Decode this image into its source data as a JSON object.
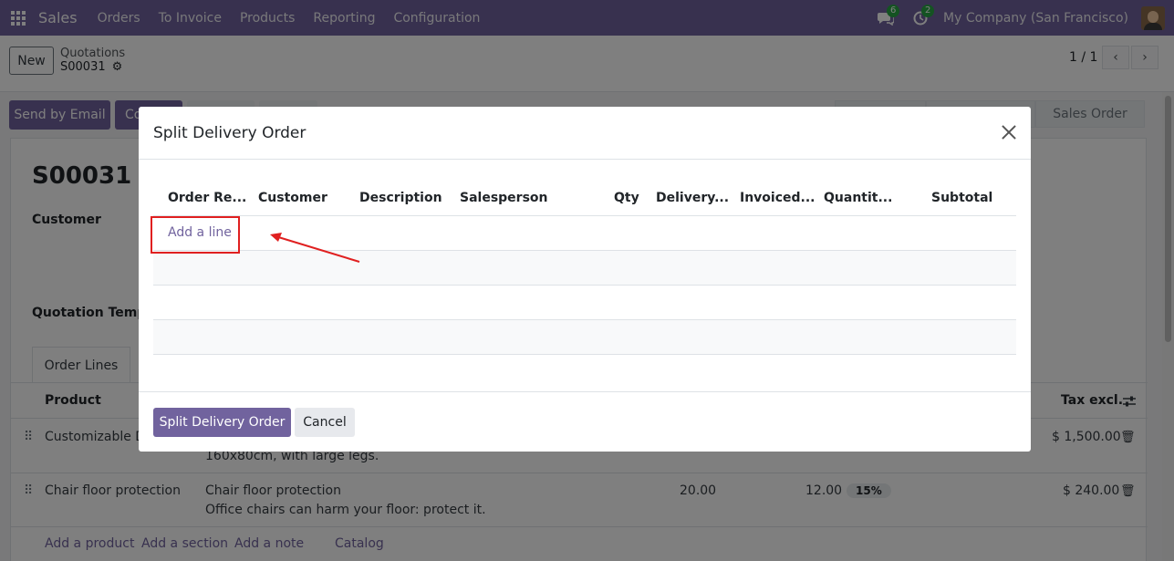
{
  "navbar": {
    "app_name": "Sales",
    "menu": [
      "Orders",
      "To Invoice",
      "Products",
      "Reporting",
      "Configuration"
    ],
    "messages_count": "6",
    "activities_count": "2",
    "company": "My Company (San Francisco)"
  },
  "control_panel": {
    "new_label": "New",
    "breadcrumb_parent": "Quotations",
    "record_name": "S00031",
    "pager": "1 / 1"
  },
  "statusbar": {
    "send_email": "Send by Email",
    "confirm_partial": "Co",
    "stage_last": "Sales Order"
  },
  "form": {
    "title": "S00031",
    "customer_label": "Customer",
    "template_label": "Quotation Templa",
    "tab_order_lines": "Order Lines",
    "col_product": "Product",
    "col_tax_excl": "Tax excl.",
    "lines": [
      {
        "product": "Customizable De",
        "desc2": "160x80cm, with large legs.",
        "subtotal": "$ 1,500.00"
      },
      {
        "product": "Chair floor protection",
        "desc1": "Chair floor protection",
        "desc2": "Office chairs can harm your floor: protect it.",
        "qty": "20.00",
        "price": "12.00",
        "tax": "15%",
        "subtotal": "$ 240.00"
      }
    ],
    "add_product": "Add a product",
    "add_section": "Add a section",
    "add_note": "Add a note",
    "catalog": "Catalog"
  },
  "dialog": {
    "title": "Split Delivery Order",
    "columns": [
      "Order Re...",
      "Customer",
      "Description",
      "Salesperson",
      "Qty",
      "Delivery...",
      "Invoiced...",
      "Quantit...",
      "Subtotal"
    ],
    "add_line": "Add a line",
    "split_button": "Split Delivery Order",
    "cancel_button": "Cancel"
  },
  "annotation_color": "#e02020",
  "accent_color": "#71639e"
}
